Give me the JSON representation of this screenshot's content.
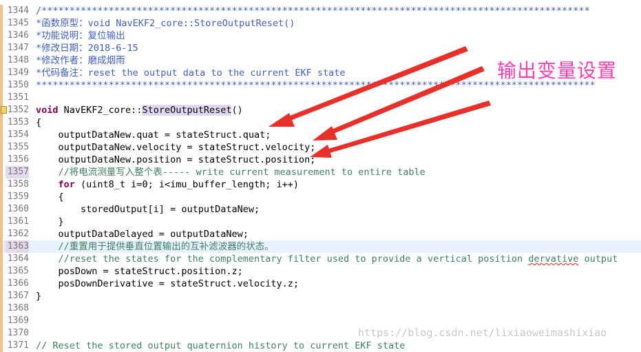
{
  "editor": {
    "lines": [
      {
        "num": "1344",
        "code": "/**************************************************************************************************",
        "style": "doc"
      },
      {
        "num": "1345",
        "code": "*函数原型：void NavEKF2_core::StoreOutputReset()",
        "style": "doc"
      },
      {
        "num": "1346",
        "code": "*功能说明：复位输出",
        "style": "doc"
      },
      {
        "num": "1347",
        "code": "*修改日期：2018-6-15",
        "style": "doc"
      },
      {
        "num": "1348",
        "code": "*修改作者：磨成烟雨",
        "style": "doc"
      },
      {
        "num": "1349",
        "code": "*代码备注：reset the output data to the current EKF state",
        "style": "doc"
      },
      {
        "num": "1350",
        "code": "****************************************************************************************************",
        "style": "doc"
      },
      {
        "num": "1351",
        "code": "",
        "style": "plain"
      },
      {
        "num": "1352",
        "code": "",
        "style": "signature",
        "kw": "void",
        "cls": " NavEKF2_core::",
        "fn": "StoreOutputReset",
        "tail": "()"
      },
      {
        "num": "1353",
        "code": "{",
        "style": "plain"
      },
      {
        "num": "1354",
        "code": "    outputDataNew.quat = stateStruct.quat;",
        "style": "plain"
      },
      {
        "num": "1355",
        "code": "    outputDataNew.velocity = stateStruct.velocity;",
        "style": "plain"
      },
      {
        "num": "1356",
        "code": "    outputDataNew.position = stateStruct.position;",
        "style": "plain"
      },
      {
        "num": "1357",
        "code": "    //将电流测量写入整个表----- write current measurement to entire table",
        "style": "comment"
      },
      {
        "num": "1358",
        "code": "",
        "style": "for",
        "kw": "for",
        "tail": " (uint8_t i=0; i<imu_buffer_length; i++)"
      },
      {
        "num": "1359",
        "code": "    {",
        "style": "plain"
      },
      {
        "num": "1360",
        "code": "        storedOutput[i] = outputDataNew;",
        "style": "plain"
      },
      {
        "num": "1361",
        "code": "    }",
        "style": "plain"
      },
      {
        "num": "1362",
        "code": "    outputDataDelayed = outputDataNew;",
        "style": "plain"
      },
      {
        "num": "1363",
        "code": "    //重置用于提供垂直位置输出的互补滤波器的状态。",
        "style": "comment"
      },
      {
        "num": "1364",
        "code": "",
        "style": "squig",
        "pre": "    //reset the states for the complementary filter used to provide a vertical position ",
        "sq": "dervative",
        "post": " output"
      },
      {
        "num": "1365",
        "code": "    posDown = stateStruct.position.z;",
        "style": "plain"
      },
      {
        "num": "1366",
        "code": "    posDownDerivative = stateStruct.velocity.z;",
        "style": "plain"
      },
      {
        "num": "1367",
        "code": "}",
        "style": "plain"
      },
      {
        "num": "1368",
        "code": "",
        "style": "plain"
      },
      {
        "num": "1369",
        "code": "",
        "style": "plain"
      },
      {
        "num": "1370",
        "code": "",
        "style": "plain"
      },
      {
        "num": "1371",
        "code": "// Reset the stored output quaternion history to current EKF state",
        "style": "comment"
      }
    ],
    "current_line": "1363",
    "highlighted_line_numbers": [
      "1357",
      "1363"
    ],
    "modified_lines": [
      "1344",
      "1345",
      "1346",
      "1347",
      "1348",
      "1349",
      "1350",
      "1351",
      "1352",
      "1353",
      "1354",
      "1355",
      "1356",
      "1357",
      "1358",
      "1359",
      "1360",
      "1361",
      "1362",
      "1363",
      "1364",
      "1365",
      "1366",
      "1367",
      "1368",
      "1369",
      "1370",
      "1371"
    ],
    "marker_line": "1352"
  },
  "annotation": {
    "text": "输出变量设置",
    "color": "#ff3cb4",
    "arrow_color": "#e8302a"
  },
  "watermark": "https://blog.csdn.net/lixiaoweimashixiao"
}
